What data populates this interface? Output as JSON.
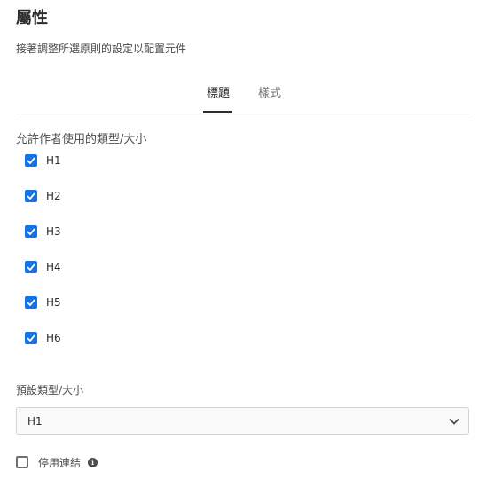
{
  "panel": {
    "title": "屬性",
    "description": "接著調整所選原則的設定以配置元件"
  },
  "tabs": [
    {
      "label": "標題",
      "selected": true
    },
    {
      "label": "樣式",
      "selected": false
    }
  ],
  "allowed_sizes": {
    "label": "允許作者使用的類型/大小",
    "options": [
      {
        "label": "H1",
        "checked": true
      },
      {
        "label": "H2",
        "checked": true
      },
      {
        "label": "H3",
        "checked": true
      },
      {
        "label": "H4",
        "checked": true
      },
      {
        "label": "H5",
        "checked": true
      },
      {
        "label": "H6",
        "checked": true
      }
    ]
  },
  "default_size": {
    "label": "預設類型/大小",
    "value": "H1",
    "icon": "chevron-down-icon"
  },
  "disable_link": {
    "label": "停用連結",
    "checked": false,
    "icon": "info-icon",
    "info_glyph": "i"
  },
  "colors": {
    "accent": "#1473e6",
    "text": "#2c2c2c",
    "muted": "#6e6e6e",
    "border": "#d3d3d3"
  }
}
